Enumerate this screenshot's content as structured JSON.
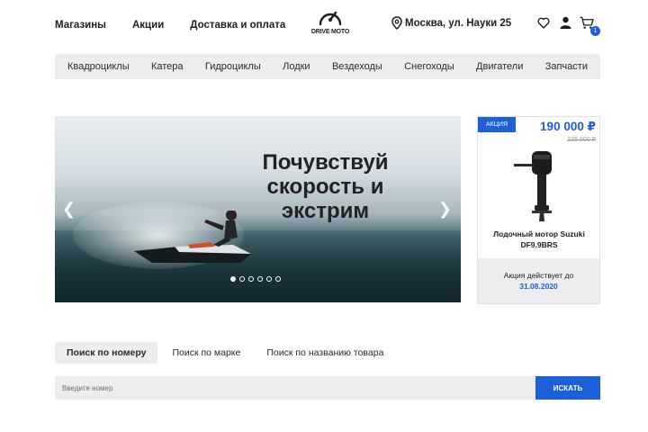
{
  "header": {
    "links": [
      "Магазины",
      "Акции",
      "Доставка и оплата"
    ],
    "logo_text": "DRIVE MOTO",
    "address": "Москва, ул. Науки 25",
    "cart_count": "1",
    "icons": [
      "heart-icon",
      "user-icon",
      "cart-icon"
    ]
  },
  "categories": [
    "Квадроциклы",
    "Катера",
    "Гидроциклы",
    "Лодки",
    "Вездеходы",
    "Снегоходы",
    "Двигатели",
    "Запчасти"
  ],
  "hero": {
    "text_lines": [
      "Почувствуй",
      "скорость и",
      "экстрим"
    ],
    "slides_total": 6,
    "active_slide": 1
  },
  "promo": {
    "badge": "АКЦИЯ",
    "price": "190 000 ₽",
    "old_price": "225 000 ₽",
    "name": "Лодочный мотор Suzuki DF9.9BRS",
    "valid_text": "Акция действует до",
    "valid_date": "31.08.2020"
  },
  "search": {
    "tabs": [
      "Поиск по номеру",
      "Поиск по марке",
      "Поиск по названию товара"
    ],
    "active_tab": 0,
    "placeholder": "Введите номер",
    "button": "ИСКАТЬ"
  },
  "colors": {
    "accent": "#1d5fd6",
    "nav_bg": "#ededf0",
    "text": "#1e1e1e"
  }
}
